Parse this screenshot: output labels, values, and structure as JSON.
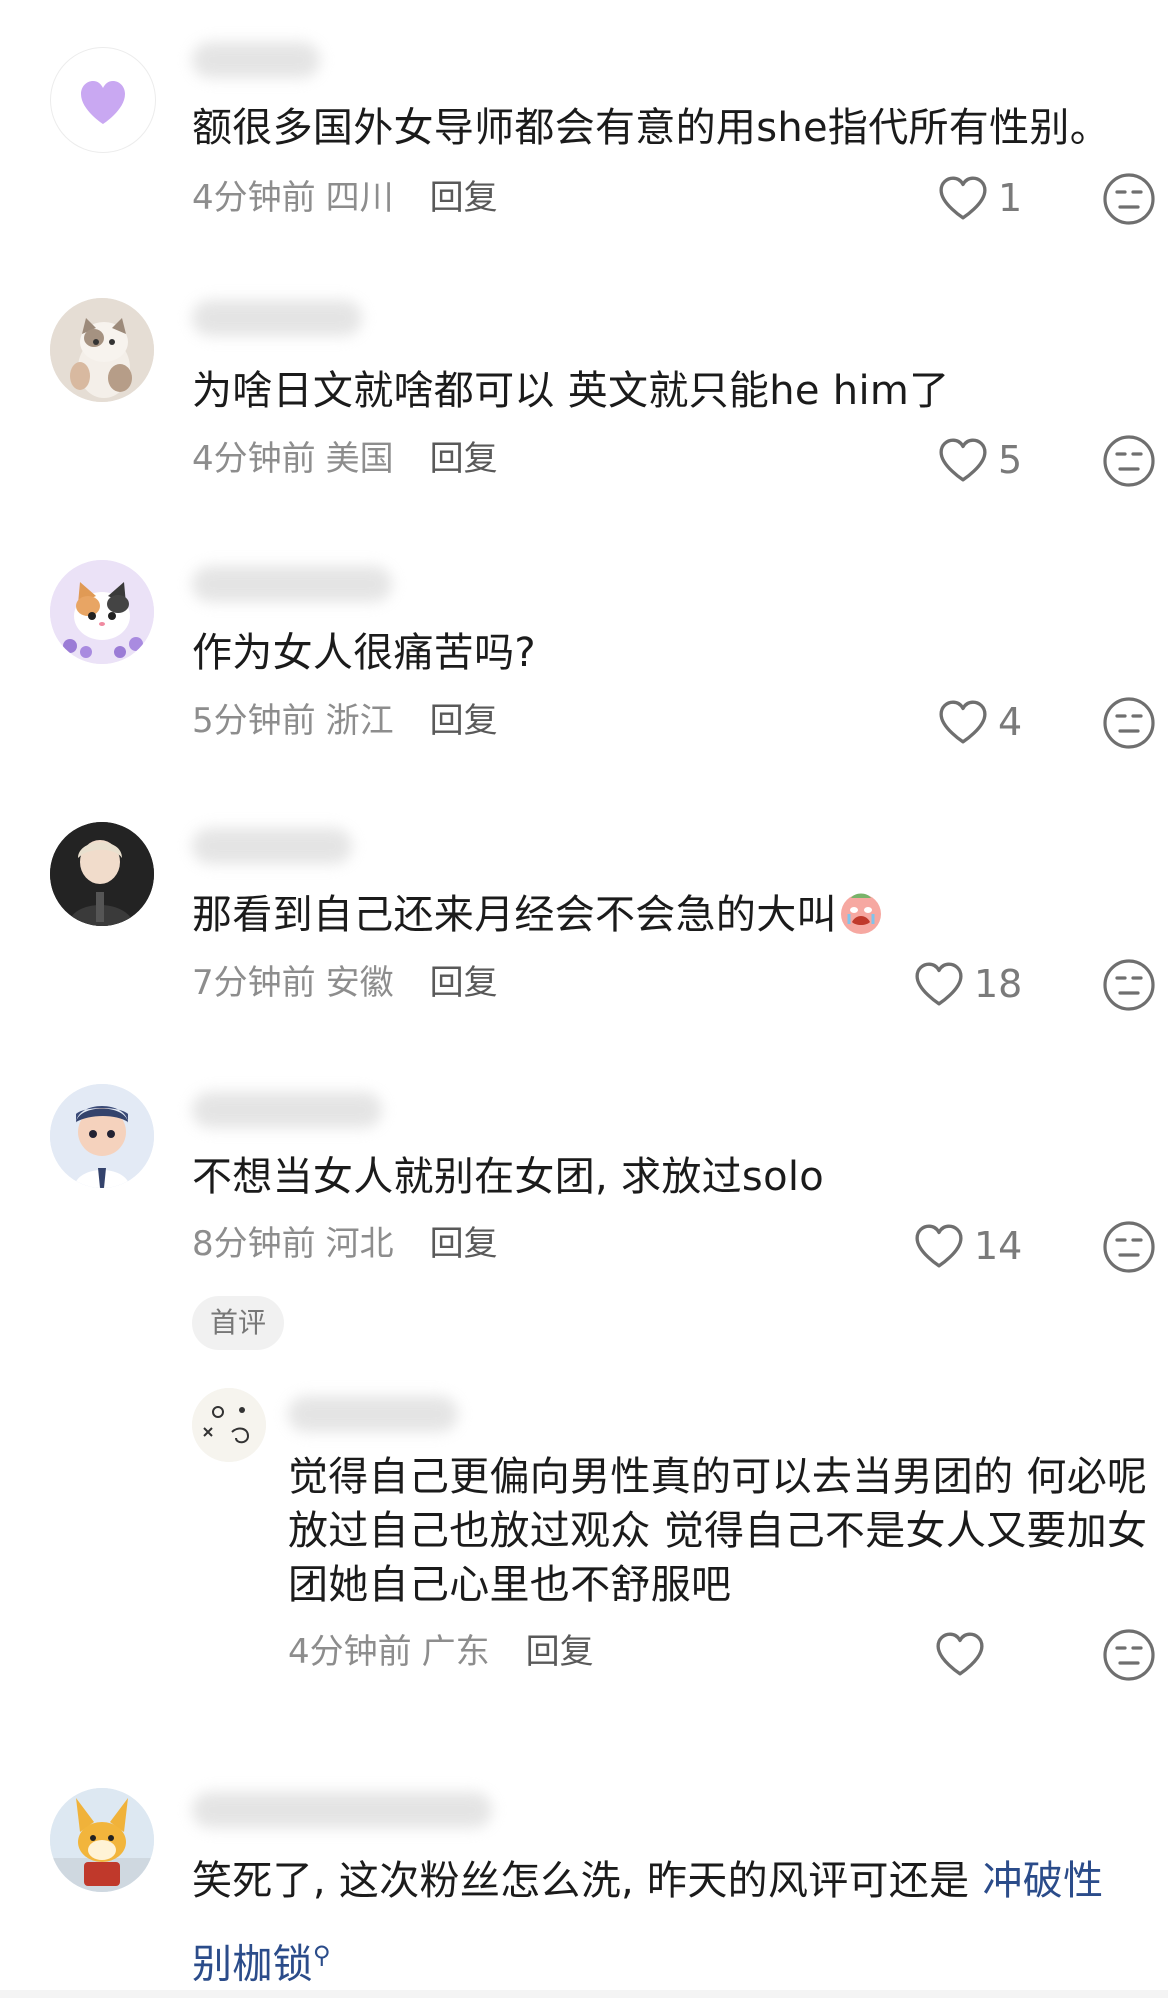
{
  "comments": [
    {
      "avatar_icon": "purple-heart-avatar",
      "text": "额很多国外女导师都会有意的用she指代所有性别。",
      "time": "4分钟前",
      "location": "四川",
      "reply": "回复",
      "likes": "1"
    },
    {
      "avatar_icon": "cat-photo-avatar",
      "text": "为啥日文就啥都可以 英文就只能he him了",
      "time": "4分钟前",
      "location": "美国",
      "reply": "回复",
      "likes": "5"
    },
    {
      "avatar_icon": "calico-cat-avatar",
      "text": "作为女人很痛苦吗?",
      "time": "5分钟前",
      "location": "浙江",
      "reply": "回复",
      "likes": "4"
    },
    {
      "avatar_icon": "person-photo-avatar",
      "text": "那看到自己还来月经会不会急的大叫",
      "emoji": "crying-face-emoji",
      "time": "7分钟前",
      "location": "安徽",
      "reply": "回复",
      "likes": "18"
    },
    {
      "avatar_icon": "cartoon-boy-avatar",
      "text": "不想当女人就别在女团, 求放过solo",
      "time": "8分钟前",
      "location": "河北",
      "reply": "回复",
      "likes": "14",
      "badge": "首评"
    }
  ],
  "reply_comment": {
    "avatar_icon": "doodle-avatar",
    "text": "觉得自己更偏向男性真的可以去当男团的 何必呢 放过自己也放过观众 觉得自己不是女人又要加女团她自己心里也不舒服吧",
    "time": "4分钟前",
    "location": "广东",
    "reply": "回复"
  },
  "last_comment": {
    "avatar_icon": "cartoon-fox-avatar",
    "text": "笑死了, 这次粉丝怎么洗, 昨天的风评可还是 ",
    "link_text": "冲破性别枷锁",
    "link_icon": "search-icon"
  },
  "colors": {
    "text": "#1b1b1b",
    "meta": "#8d8d8d",
    "link": "#2b4c8a"
  }
}
